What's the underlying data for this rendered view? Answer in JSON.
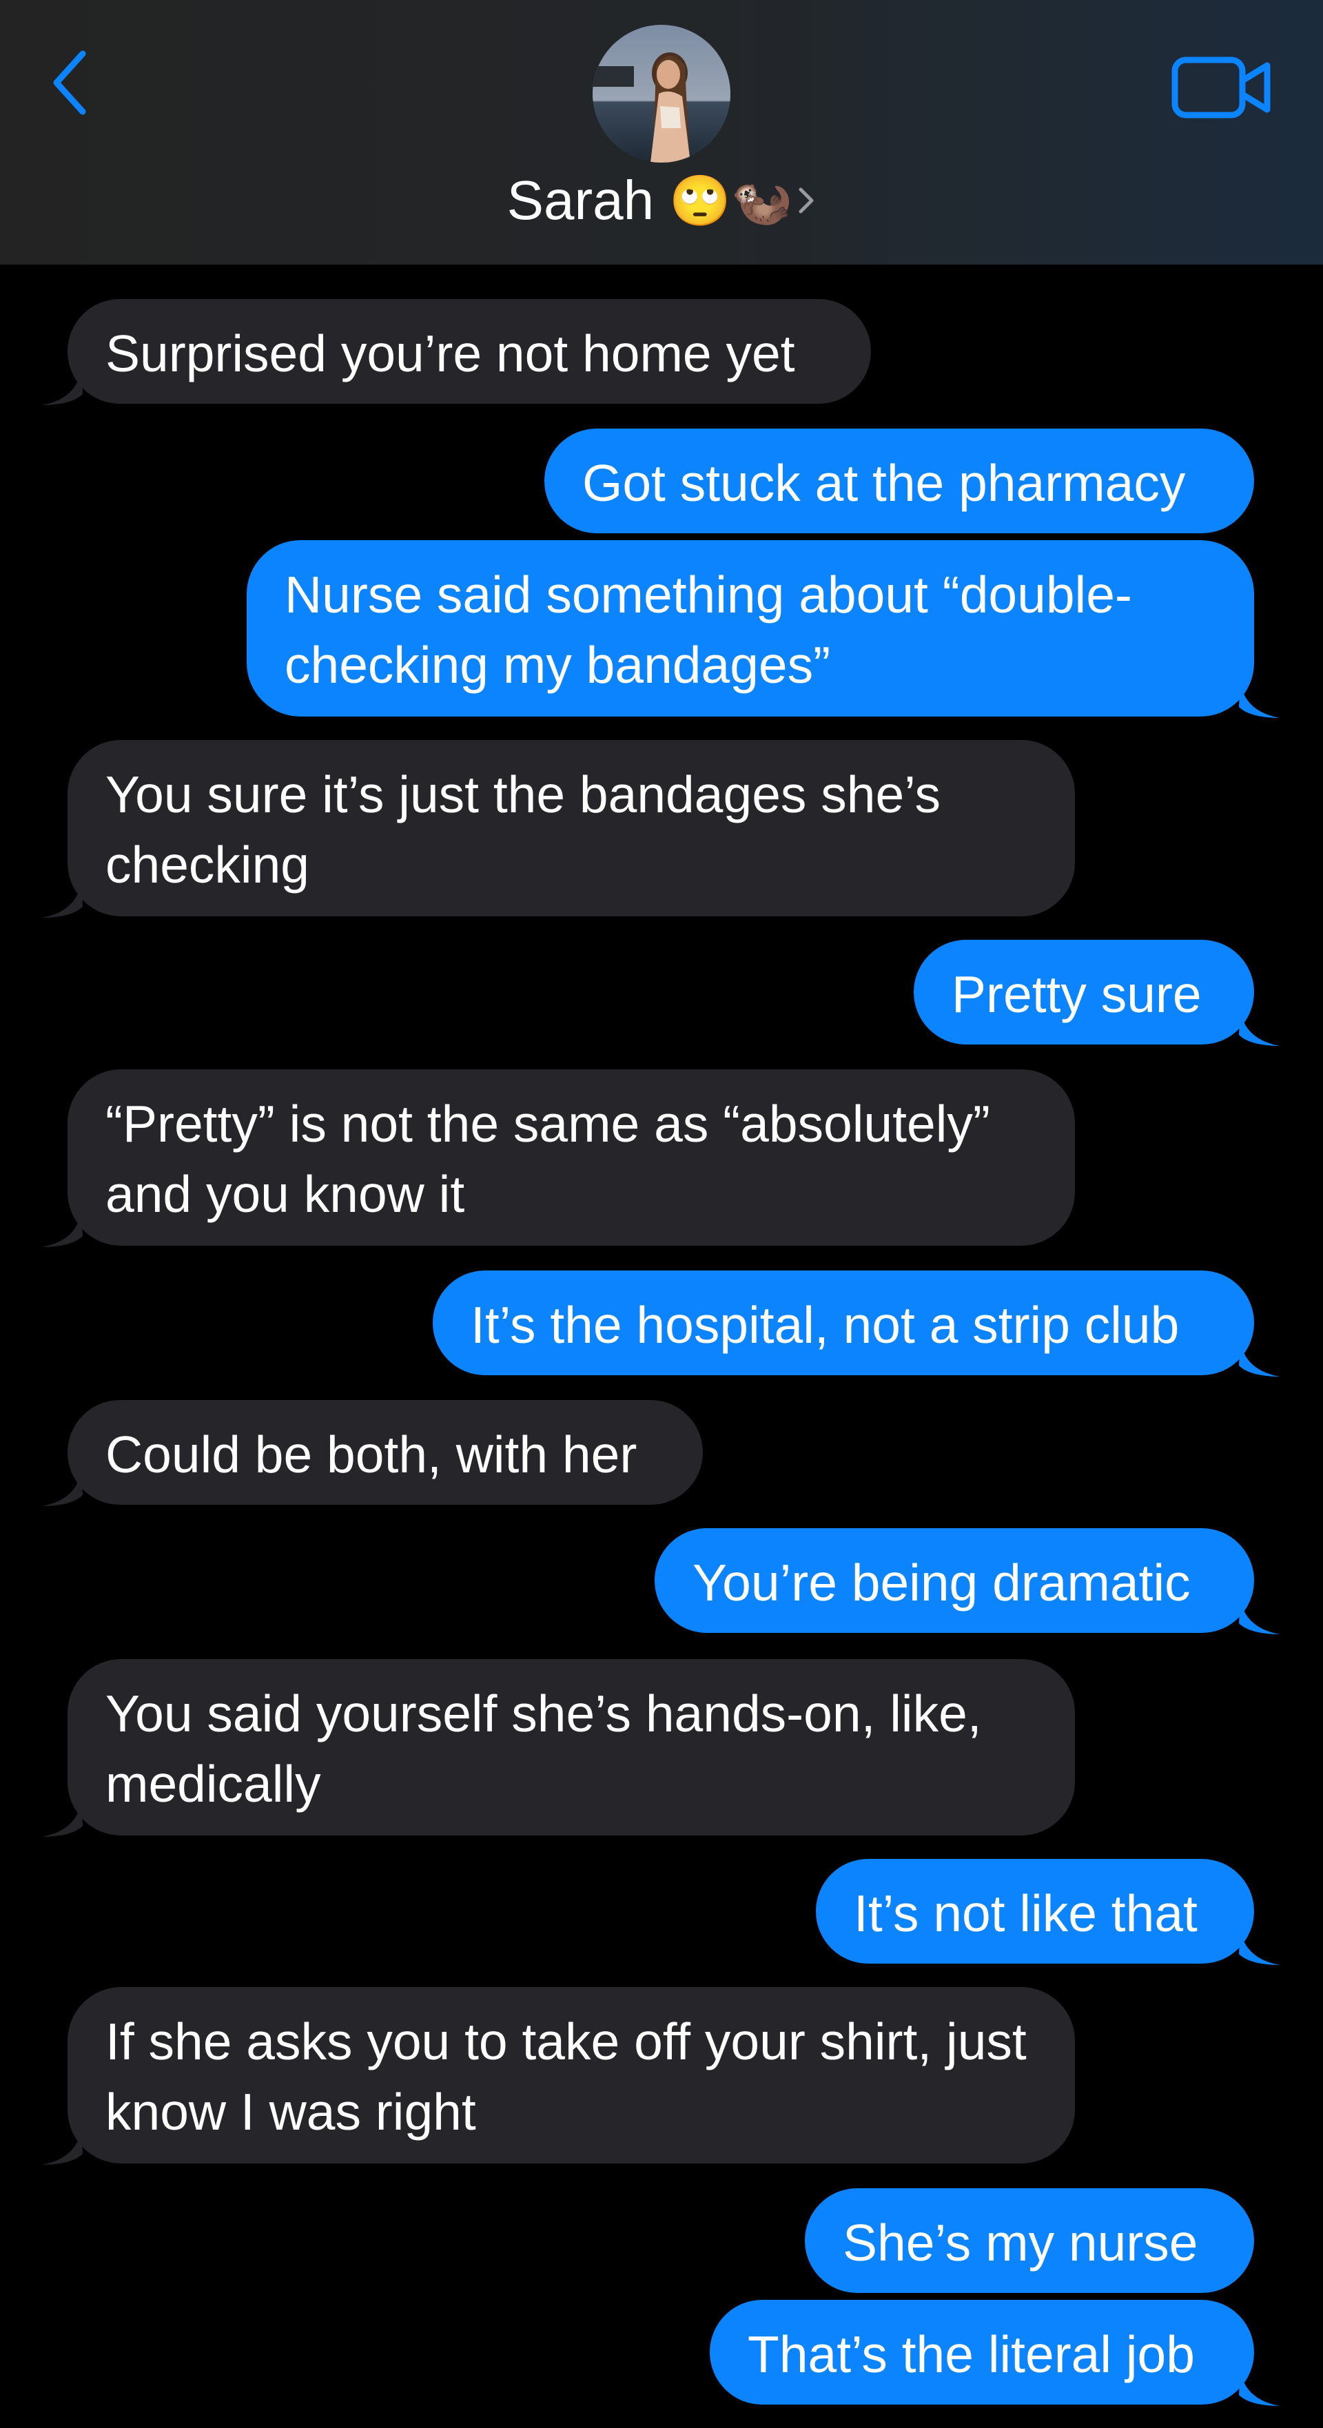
{
  "header": {
    "contact_name": "Sarah",
    "name_emoji": "🙄🦦",
    "back_icon": "chevron-left-icon",
    "video_icon": "video-camera-icon",
    "accent_color": "#0b84fe"
  },
  "conversation": {
    "messages": [
      {
        "from": "them",
        "text": "Surprised you’re not home yet"
      },
      {
        "from": "me",
        "text": "Got stuck at the pharmacy"
      },
      {
        "from": "me",
        "text": "Nurse said something about “double-checking my bandages”"
      },
      {
        "from": "them",
        "text": "You sure it’s just the bandages she’s checking"
      },
      {
        "from": "me",
        "text": "Pretty sure"
      },
      {
        "from": "them",
        "text": "“Pretty” is not the same as “absolutely” and you know it"
      },
      {
        "from": "me",
        "text": "It’s the hospital, not a strip club"
      },
      {
        "from": "them",
        "text": "Could be both, with her"
      },
      {
        "from": "me",
        "text": "You’re being dramatic"
      },
      {
        "from": "them",
        "text": "You said yourself she’s hands-on, like, medically"
      },
      {
        "from": "me",
        "text": "It’s not like that"
      },
      {
        "from": "them",
        "text": "If she asks you to take off your shirt, just know I was right"
      },
      {
        "from": "me",
        "text": "She’s my nurse"
      },
      {
        "from": "me",
        "text": "That’s the literal job"
      }
    ],
    "incoming_bubble_color": "#26252a",
    "outgoing_bubble_color": "#0b84fe"
  }
}
